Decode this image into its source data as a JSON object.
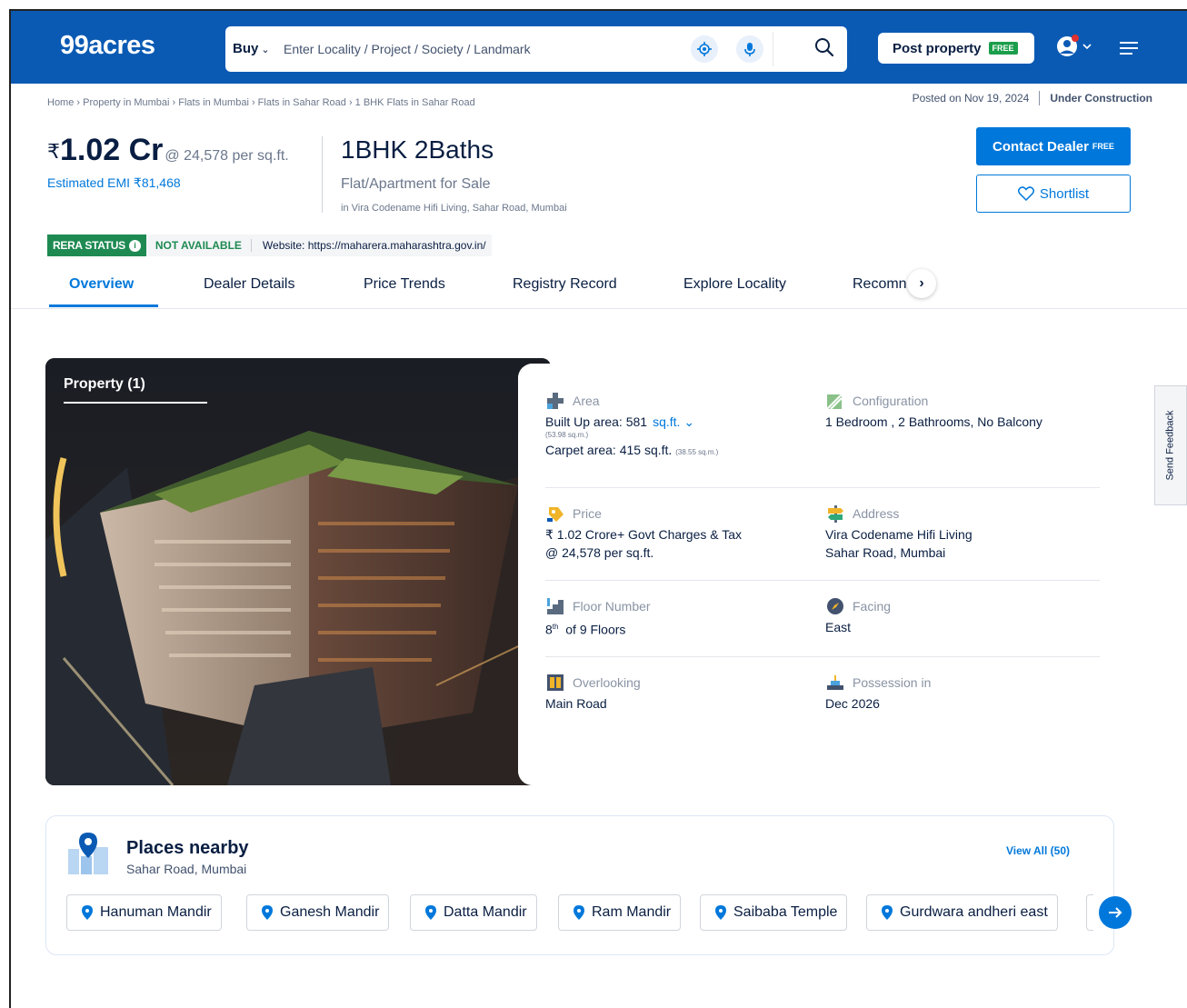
{
  "header": {
    "logo": "99acres",
    "buy_label": "Buy",
    "search_placeholder": "Enter Locality / Project / Society / Landmark",
    "post_property_label": "Post property",
    "post_property_tag": "FREE",
    "accent_color": "#0a5ab4"
  },
  "breadcrumb": "Home › Property in Mumbai › Flats in Mumbai › Flats in Sahar Road › 1 BHK Flats in Sahar Road",
  "meta": {
    "posted": "Posted on Nov 19, 2024",
    "status": "Under Construction"
  },
  "listing": {
    "rupee": "₹",
    "price": "1.02 Cr",
    "price_per_sqft": "@ 24,578 per sq.ft.",
    "emi": "Estimated EMI ₹81,468",
    "config": "1BHK 2Baths",
    "type": "Flat/Apartment for Sale",
    "location": "in Vira Codename Hifi Living, Sahar Road, Mumbai"
  },
  "actions": {
    "contact_label": "Contact Dealer",
    "contact_tag": "FREE",
    "shortlist_label": "Shortlist"
  },
  "rera": {
    "label": "RERA STATUS",
    "info_glyph": "i",
    "status": "NOT AVAILABLE",
    "website": "Website: https://maharera.maharashtra.gov.in/"
  },
  "tabs": [
    "Overview",
    "Dealer Details",
    "Price Trends",
    "Registry Record",
    "Explore Locality",
    "Recomn"
  ],
  "tab_next_glyph": "›",
  "photo": {
    "label": "Property (1)"
  },
  "details": {
    "area": {
      "label": "Area",
      "built_up": "Built Up area: 581",
      "built_up_unit": "sq.ft.",
      "built_up_sqm": "(53.98 sq.m.)",
      "carpet": "Carpet area: 415 sq.ft.",
      "carpet_sqm": "(38.55 sq.m.)"
    },
    "configuration": {
      "label": "Configuration",
      "value": "1 Bedroom , 2 Bathrooms, No Balcony"
    },
    "price": {
      "label": "Price",
      "line1": "₹ 1.02 Crore+ Govt Charges & Tax",
      "line2": "@ 24,578 per sq.ft."
    },
    "address": {
      "label": "Address",
      "line1": "Vira Codename Hifi Living",
      "line2": "Sahar Road, Mumbai"
    },
    "floor": {
      "label": "Floor Number",
      "number": "8",
      "suffix": "th",
      "rest": "of 9 Floors"
    },
    "facing": {
      "label": "Facing",
      "value": "East"
    },
    "overlooking": {
      "label": "Overlooking",
      "value": "Main Road"
    },
    "possession": {
      "label": "Possession in",
      "value": "Dec 2026"
    }
  },
  "feedback_label": "Send Feedback",
  "places": {
    "title": "Places nearby",
    "subtitle": "Sahar Road, Mumbai",
    "view_all": "View All (50)",
    "items": [
      "Hanuman Mandir",
      "Ganesh Mandir",
      "Datta Mandir",
      "Ram Mandir",
      "Saibaba Temple",
      "Gurdwara andheri east"
    ]
  }
}
